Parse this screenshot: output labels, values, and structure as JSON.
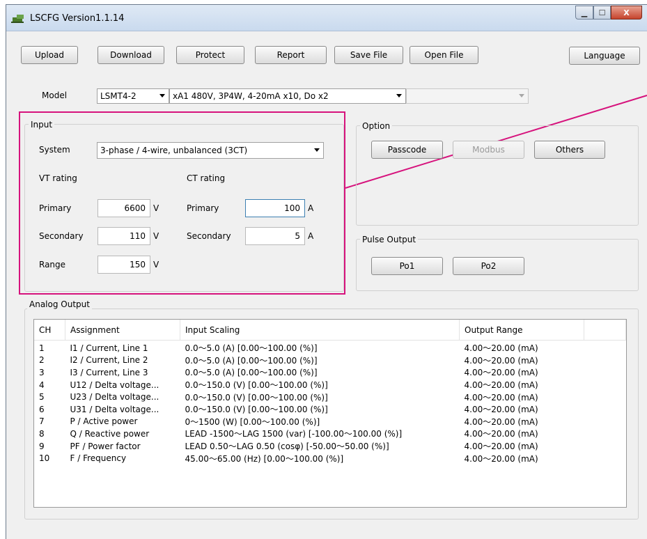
{
  "window": {
    "title": "LSCFG Version1.1.14"
  },
  "titlebar_controls": {
    "minimize": "▁",
    "maximize": "☐",
    "close": "X"
  },
  "toolbar": {
    "upload": "Upload",
    "download": "Download",
    "protect": "Protect",
    "report": "Report",
    "save_file": "Save File",
    "open_file": "Open File",
    "language": "Language"
  },
  "model": {
    "label": "Model",
    "selected": "LSMT4-2",
    "config": "xA1 480V, 3P4W, 4-20mA x10, Do x2",
    "third": ""
  },
  "input": {
    "title": "Input",
    "system_label": "System",
    "system_value": "3-phase / 4-wire, unbalanced (3CT)",
    "vt_label": "VT rating",
    "ct_label": "CT rating",
    "vt": {
      "primary_label": "Primary",
      "primary_value": "6600",
      "primary_unit": "V",
      "secondary_label": "Secondary",
      "secondary_value": "110",
      "secondary_unit": "V",
      "range_label": "Range",
      "range_value": "150",
      "range_unit": "V"
    },
    "ct": {
      "primary_label": "Primary",
      "primary_value": "100",
      "primary_unit": "A",
      "secondary_label": "Secondary",
      "secondary_value": "5",
      "secondary_unit": "A"
    }
  },
  "option": {
    "title": "Option",
    "passcode": "Passcode",
    "modbus": "Modbus",
    "others": "Others"
  },
  "pulse_output": {
    "title": "Pulse Output",
    "po1": "Po1",
    "po2": "Po2"
  },
  "analog_output": {
    "title": "Analog Output",
    "columns": [
      "CH",
      "Assignment",
      "Input Scaling",
      "Output Range"
    ],
    "rows": [
      [
        "1",
        "I1 / Current, Line 1",
        "0.0〜5.0 (A) [0.00〜100.00 (%)]",
        "4.00〜20.00 (mA)"
      ],
      [
        "2",
        "I2 / Current, Line 2",
        "0.0〜5.0 (A) [0.00〜100.00 (%)]",
        "4.00〜20.00 (mA)"
      ],
      [
        "3",
        "I3 / Current, Line 3",
        "0.0〜5.0 (A) [0.00〜100.00 (%)]",
        "4.00〜20.00 (mA)"
      ],
      [
        "4",
        "U12 / Delta voltage...",
        "0.0〜150.0 (V) [0.00〜100.00 (%)]",
        "4.00〜20.00 (mA)"
      ],
      [
        "5",
        "U23 / Delta voltage...",
        "0.0〜150.0 (V) [0.00〜100.00 (%)]",
        "4.00〜20.00 (mA)"
      ],
      [
        "6",
        "U31 / Delta voltage...",
        "0.0〜150.0 (V) [0.00〜100.00 (%)]",
        "4.00〜20.00 (mA)"
      ],
      [
        "7",
        "P / Active power",
        "0〜1500 (W) [0.00〜100.00 (%)]",
        "4.00〜20.00 (mA)"
      ],
      [
        "8",
        "Q / Reactive power",
        "LEAD -1500〜LAG 1500 (var) [-100.00〜100.00 (%)]",
        "4.00〜20.00 (mA)"
      ],
      [
        "9",
        "PF / Power factor",
        "LEAD 0.50〜LAG 0.50 (cosφ) [-50.00〜50.00 (%)]",
        "4.00〜20.00 (mA)"
      ],
      [
        "10",
        "F / Frequency",
        "45.00〜65.00 (Hz) [0.00〜100.00 (%)]",
        "4.00〜20.00 (mA)"
      ]
    ]
  },
  "colors": {
    "highlight": "#d6127c",
    "window_bg": "#f0f0f0"
  }
}
